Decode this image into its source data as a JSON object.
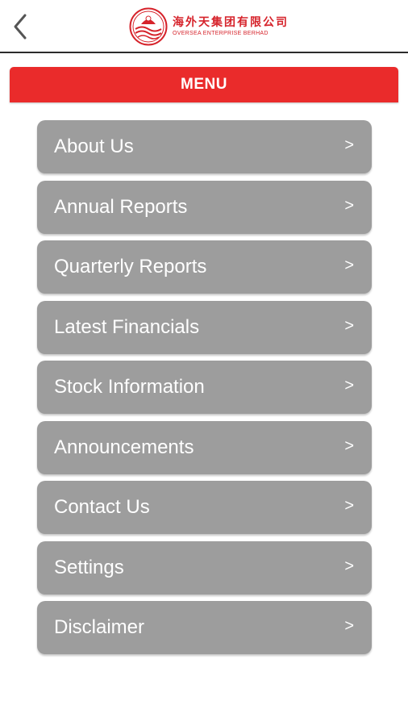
{
  "header": {
    "back_icon": "chevron-left-icon",
    "logo": {
      "name_cn": "海外天集团有限公司",
      "name_en": "OVERSEA ENTERPRISE BERHAD"
    }
  },
  "menu": {
    "title": "MENU",
    "items": [
      {
        "label": "About Us",
        "arrow": ">"
      },
      {
        "label": "Annual Reports",
        "arrow": ">"
      },
      {
        "label": "Quarterly Reports",
        "arrow": ">"
      },
      {
        "label": "Latest Financials",
        "arrow": ">"
      },
      {
        "label": "Stock Information",
        "arrow": ">"
      },
      {
        "label": "Announcements",
        "arrow": ">"
      },
      {
        "label": "Contact Us",
        "arrow": ">"
      },
      {
        "label": "Settings",
        "arrow": ">"
      },
      {
        "label": "Disclaimer",
        "arrow": ">"
      }
    ]
  },
  "colors": {
    "brand_red": "#d6232b",
    "menu_bar": "#ea2b2b",
    "menu_item": "#9d9d9d",
    "text_on_item": "#ffffff"
  }
}
